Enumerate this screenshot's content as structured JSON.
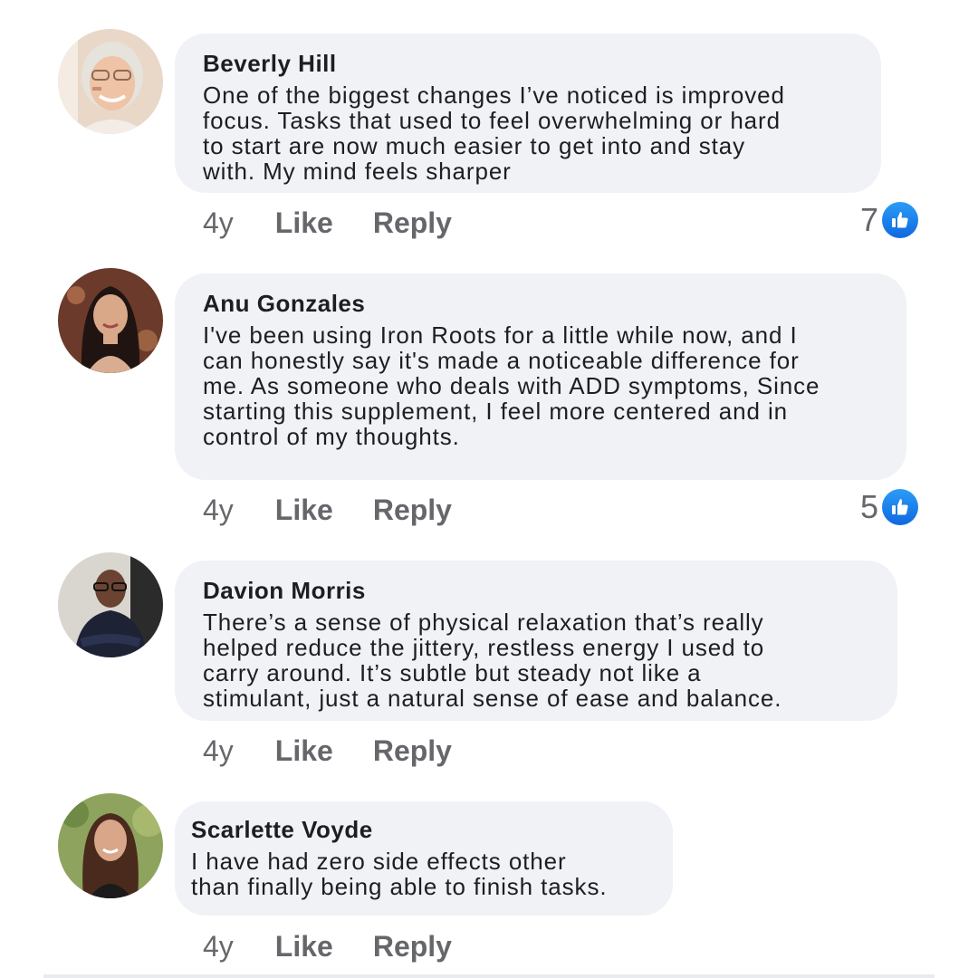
{
  "comments": [
    {
      "author": "Beverly Hill",
      "lines": [
        "One of the biggest changes I’ve noticed is improved",
        "focus. Tasks that used to feel overwhelming or hard",
        "to start are now much easier to get into and stay",
        "with. My mind feels sharper"
      ],
      "age": "4y",
      "like_label": "Like",
      "reply_label": "Reply",
      "reaction_count": "7"
    },
    {
      "author": "Anu Gonzales",
      "lines": [
        "I've been using Iron Roots for a little while now, and I",
        "can honestly say it's made a noticeable difference for",
        "me. As someone who deals with ADD symptoms,  Since",
        "starting this supplement, I feel more centered and in",
        "control of my thoughts."
      ],
      "age": "4y",
      "like_label": "Like",
      "reply_label": "Reply",
      "reaction_count": "5"
    },
    {
      "author": "Davion Morris",
      "lines": [
        "There’s a sense of physical relaxation that’s really",
        "helped reduce the jittery, restless energy I used to",
        "carry around. It’s subtle but steady not like a",
        "stimulant, just a natural sense of ease and balance."
      ],
      "age": "4y",
      "like_label": "Like",
      "reply_label": "Reply"
    },
    {
      "author": "Scarlette Voyde",
      "lines": [
        "I have had zero side effects other",
        "than finally being able to finish tasks."
      ],
      "age": "4y",
      "like_label": "Like",
      "reply_label": "Reply"
    }
  ],
  "icons": {
    "reaction": "thumbs-up-icon"
  },
  "colors": {
    "bubble": "#f0f2f5",
    "like_blue": "#1877f2",
    "meta_gray": "#65676b"
  }
}
